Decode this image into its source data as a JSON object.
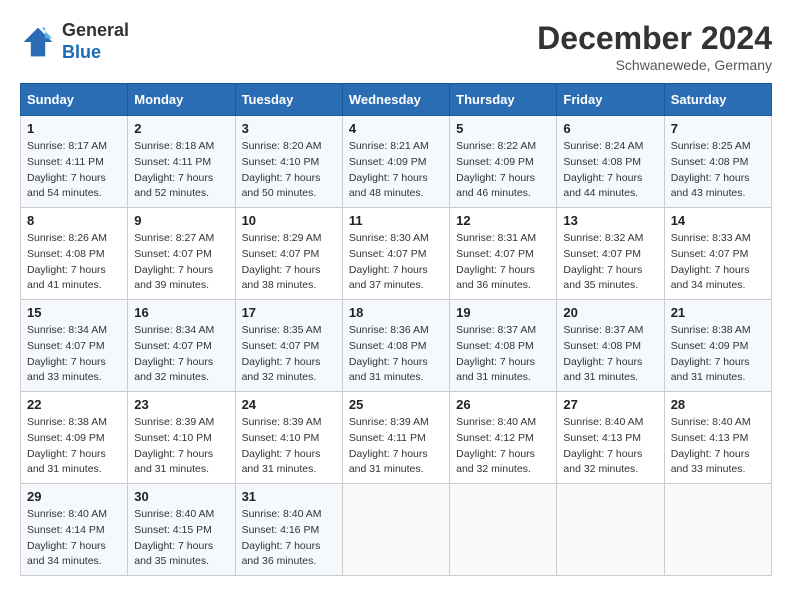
{
  "header": {
    "logo_line1": "General",
    "logo_line2": "Blue",
    "month_title": "December 2024",
    "location": "Schwanewede, Germany"
  },
  "weekdays": [
    "Sunday",
    "Monday",
    "Tuesday",
    "Wednesday",
    "Thursday",
    "Friday",
    "Saturday"
  ],
  "weeks": [
    [
      {
        "day": "1",
        "sunrise": "8:17 AM",
        "sunset": "4:11 PM",
        "daylight": "7 hours and 54 minutes."
      },
      {
        "day": "2",
        "sunrise": "8:18 AM",
        "sunset": "4:11 PM",
        "daylight": "7 hours and 52 minutes."
      },
      {
        "day": "3",
        "sunrise": "8:20 AM",
        "sunset": "4:10 PM",
        "daylight": "7 hours and 50 minutes."
      },
      {
        "day": "4",
        "sunrise": "8:21 AM",
        "sunset": "4:09 PM",
        "daylight": "7 hours and 48 minutes."
      },
      {
        "day": "5",
        "sunrise": "8:22 AM",
        "sunset": "4:09 PM",
        "daylight": "7 hours and 46 minutes."
      },
      {
        "day": "6",
        "sunrise": "8:24 AM",
        "sunset": "4:08 PM",
        "daylight": "7 hours and 44 minutes."
      },
      {
        "day": "7",
        "sunrise": "8:25 AM",
        "sunset": "4:08 PM",
        "daylight": "7 hours and 43 minutes."
      }
    ],
    [
      {
        "day": "8",
        "sunrise": "8:26 AM",
        "sunset": "4:08 PM",
        "daylight": "7 hours and 41 minutes."
      },
      {
        "day": "9",
        "sunrise": "8:27 AM",
        "sunset": "4:07 PM",
        "daylight": "7 hours and 39 minutes."
      },
      {
        "day": "10",
        "sunrise": "8:29 AM",
        "sunset": "4:07 PM",
        "daylight": "7 hours and 38 minutes."
      },
      {
        "day": "11",
        "sunrise": "8:30 AM",
        "sunset": "4:07 PM",
        "daylight": "7 hours and 37 minutes."
      },
      {
        "day": "12",
        "sunrise": "8:31 AM",
        "sunset": "4:07 PM",
        "daylight": "7 hours and 36 minutes."
      },
      {
        "day": "13",
        "sunrise": "8:32 AM",
        "sunset": "4:07 PM",
        "daylight": "7 hours and 35 minutes."
      },
      {
        "day": "14",
        "sunrise": "8:33 AM",
        "sunset": "4:07 PM",
        "daylight": "7 hours and 34 minutes."
      }
    ],
    [
      {
        "day": "15",
        "sunrise": "8:34 AM",
        "sunset": "4:07 PM",
        "daylight": "7 hours and 33 minutes."
      },
      {
        "day": "16",
        "sunrise": "8:34 AM",
        "sunset": "4:07 PM",
        "daylight": "7 hours and 32 minutes."
      },
      {
        "day": "17",
        "sunrise": "8:35 AM",
        "sunset": "4:07 PM",
        "daylight": "7 hours and 32 minutes."
      },
      {
        "day": "18",
        "sunrise": "8:36 AM",
        "sunset": "4:08 PM",
        "daylight": "7 hours and 31 minutes."
      },
      {
        "day": "19",
        "sunrise": "8:37 AM",
        "sunset": "4:08 PM",
        "daylight": "7 hours and 31 minutes."
      },
      {
        "day": "20",
        "sunrise": "8:37 AM",
        "sunset": "4:08 PM",
        "daylight": "7 hours and 31 minutes."
      },
      {
        "day": "21",
        "sunrise": "8:38 AM",
        "sunset": "4:09 PM",
        "daylight": "7 hours and 31 minutes."
      }
    ],
    [
      {
        "day": "22",
        "sunrise": "8:38 AM",
        "sunset": "4:09 PM",
        "daylight": "7 hours and 31 minutes."
      },
      {
        "day": "23",
        "sunrise": "8:39 AM",
        "sunset": "4:10 PM",
        "daylight": "7 hours and 31 minutes."
      },
      {
        "day": "24",
        "sunrise": "8:39 AM",
        "sunset": "4:10 PM",
        "daylight": "7 hours and 31 minutes."
      },
      {
        "day": "25",
        "sunrise": "8:39 AM",
        "sunset": "4:11 PM",
        "daylight": "7 hours and 31 minutes."
      },
      {
        "day": "26",
        "sunrise": "8:40 AM",
        "sunset": "4:12 PM",
        "daylight": "7 hours and 32 minutes."
      },
      {
        "day": "27",
        "sunrise": "8:40 AM",
        "sunset": "4:13 PM",
        "daylight": "7 hours and 32 minutes."
      },
      {
        "day": "28",
        "sunrise": "8:40 AM",
        "sunset": "4:13 PM",
        "daylight": "7 hours and 33 minutes."
      }
    ],
    [
      {
        "day": "29",
        "sunrise": "8:40 AM",
        "sunset": "4:14 PM",
        "daylight": "7 hours and 34 minutes."
      },
      {
        "day": "30",
        "sunrise": "8:40 AM",
        "sunset": "4:15 PM",
        "daylight": "7 hours and 35 minutes."
      },
      {
        "day": "31",
        "sunrise": "8:40 AM",
        "sunset": "4:16 PM",
        "daylight": "7 hours and 36 minutes."
      },
      null,
      null,
      null,
      null
    ]
  ]
}
